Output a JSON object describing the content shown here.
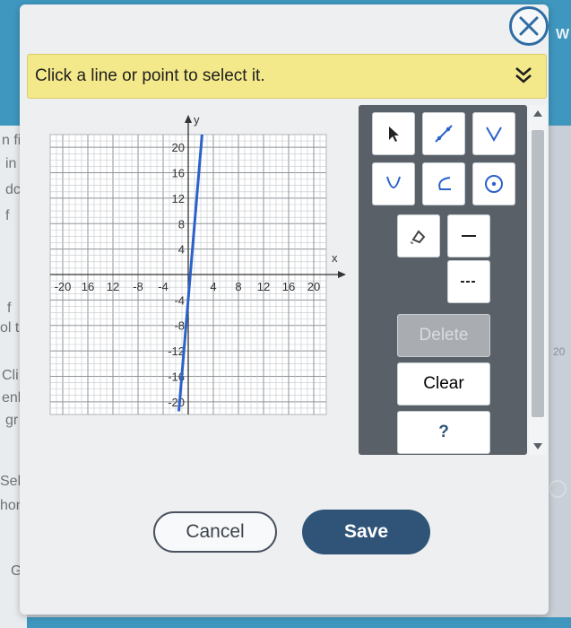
{
  "background": {
    "left_fragments": [
      "n fi",
      "in",
      "dc",
      "f",
      "f",
      "ol t",
      "Cli",
      "enl",
      "gr",
      "Sele",
      "hon",
      "G"
    ],
    "right_fragment": "W",
    "right_number": "20"
  },
  "dialog": {
    "close_icon": "close-icon",
    "banner": {
      "text": "Click a line or point to select it.",
      "collapse_icon": "double-chevron-down-icon"
    }
  },
  "graph": {
    "x_axis_label": "x",
    "y_axis_label": "y",
    "x_tick_labels": [
      "-20",
      "16",
      "12",
      "-8",
      "-4",
      "4",
      "8",
      "12",
      "16",
      "20"
    ],
    "y_tick_labels": [
      "20",
      "16",
      "12",
      "8",
      "4",
      "-4",
      "-8",
      "-12",
      "-16",
      "-20"
    ],
    "line_color": "#2a62c9"
  },
  "toolbar": {
    "tools": [
      {
        "name": "select-pointer-icon"
      },
      {
        "name": "line-tool-icon"
      },
      {
        "name": "absolute-value-tool-icon"
      },
      {
        "name": "parabola-up-tool-icon"
      },
      {
        "name": "curve-tool-icon"
      },
      {
        "name": "circle-tool-icon"
      },
      {
        "name": "fill-region-icon"
      },
      {
        "name": "solid-line-icon"
      },
      {
        "name": "dashed-line-icon"
      }
    ],
    "delete_label": "Delete",
    "clear_label": "Clear",
    "help_label": "?"
  },
  "footer": {
    "cancel_label": "Cancel",
    "save_label": "Save"
  },
  "colors": {
    "accent": "#2f5478",
    "banner": "#f4e98a",
    "toolbar": "#5a6068"
  }
}
